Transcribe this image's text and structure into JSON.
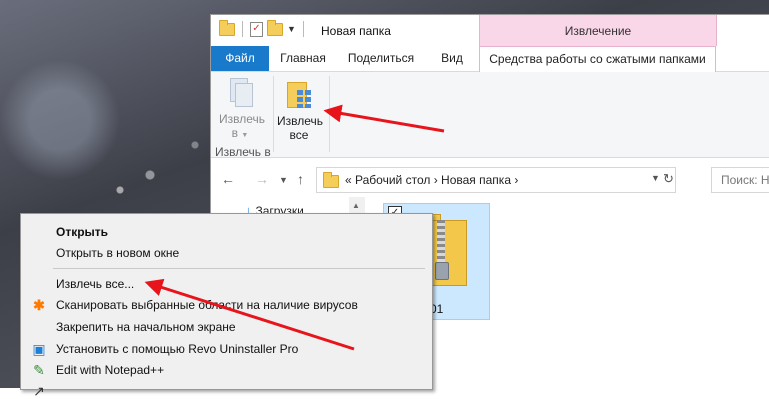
{
  "window": {
    "title": "Новая папка",
    "context_tab_header": "Извлечение"
  },
  "ribbon_tabs": {
    "file": "Файл",
    "home": "Главная",
    "share": "Поделиться",
    "view": "Вид",
    "tools": "Средства работы со сжатыми папками"
  },
  "ribbon": {
    "extract_to_line1": "Извлечь",
    "extract_to_line2": "в",
    "extract_all_line1": "Извлечь",
    "extract_all_line2": "все",
    "group_label": "Извлечь в"
  },
  "address": {
    "prefix": "«",
    "crumb1": "Рабочий стол",
    "crumb2": "Новая папка",
    "search_placeholder": "Поиск: Н"
  },
  "nav_pane": {
    "downloads": "Загрузки"
  },
  "file": {
    "label": "01",
    "checked": true
  },
  "context_menu": {
    "open": "Открыть",
    "open_new_window": "Открыть в новом окне",
    "extract_all": "Извлечь все...",
    "scan": "Сканировать выбранные области на наличие вирусов",
    "pin_start": "Закрепить на начальном экране",
    "revo": "Установить с помощью Revo Uninstaller Pro",
    "notepad": "Edit with Notepad++"
  },
  "colors": {
    "file_tab": "#1979ca",
    "context_tab": "#f9d6e8",
    "selection": "#cce8ff",
    "annotation_arrow": "#e8141c"
  }
}
